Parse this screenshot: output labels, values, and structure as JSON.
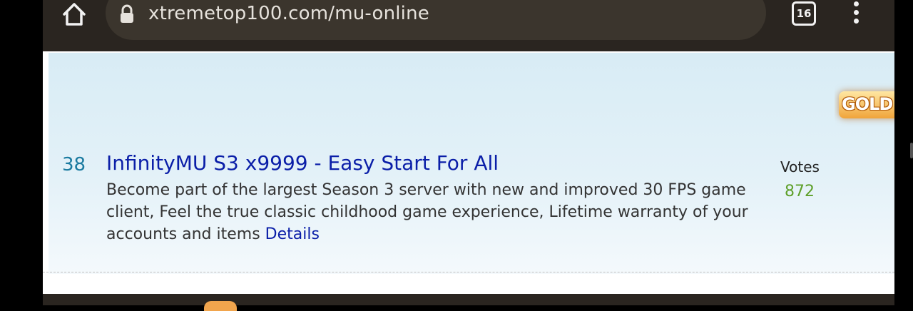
{
  "browser": {
    "url": "xtremetop100.com/mu-online",
    "tab_count": "16"
  },
  "listing": {
    "rank": "38",
    "title": "InfinityMU S3 x9999 - Easy Start For All",
    "description": "Become part of the largest Season 3 server with new and improved 30 FPS game client, Feel the true classic childhood game experience, Lifetime warranty of your accounts and items ",
    "details_label": "Details",
    "votes_label": "Votes",
    "votes_count": "872",
    "badge_text": "GOLD"
  },
  "colors": {
    "title_link": "#0a1ea8",
    "rank": "#1a7aa0",
    "votes_count": "#5ea02a",
    "listing_bg": "#d8ecf5"
  },
  "icons": {
    "home": "home-icon",
    "lock": "lock-icon",
    "tabs": "tab-switcher-icon",
    "menu": "more-vert-icon"
  }
}
